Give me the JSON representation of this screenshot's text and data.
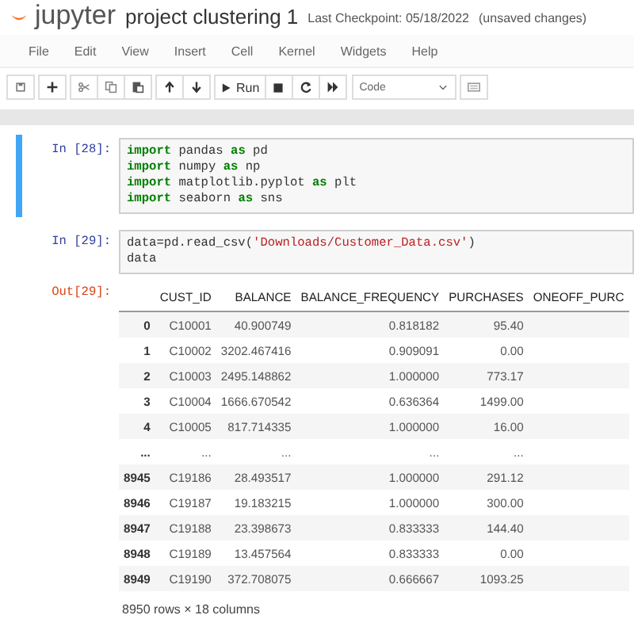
{
  "header": {
    "logo": "jupyter",
    "title": "project clustering 1",
    "checkpoint": "Last Checkpoint: 05/18/2022",
    "status": "(unsaved changes)"
  },
  "menu": [
    "File",
    "Edit",
    "View",
    "Insert",
    "Cell",
    "Kernel",
    "Widgets",
    "Help"
  ],
  "toolbar": {
    "run_label": "Run",
    "cell_type": "Code"
  },
  "cells": [
    {
      "prompt": "In [28]:",
      "selected": true,
      "lines": [
        [
          {
            "kind": "keyword",
            "text": "import"
          },
          {
            "kind": "plain",
            "text": " pandas "
          },
          {
            "kind": "keyword",
            "text": "as"
          },
          {
            "kind": "plain",
            "text": " pd"
          }
        ],
        [
          {
            "kind": "keyword",
            "text": "import"
          },
          {
            "kind": "plain",
            "text": " numpy "
          },
          {
            "kind": "keyword",
            "text": "as"
          },
          {
            "kind": "plain",
            "text": " np"
          }
        ],
        [
          {
            "kind": "keyword",
            "text": "import"
          },
          {
            "kind": "plain",
            "text": " matplotlib.pyplot "
          },
          {
            "kind": "keyword",
            "text": "as"
          },
          {
            "kind": "plain",
            "text": " plt"
          }
        ],
        [
          {
            "kind": "keyword",
            "text": "import"
          },
          {
            "kind": "plain",
            "text": " seaborn "
          },
          {
            "kind": "keyword",
            "text": "as"
          },
          {
            "kind": "plain",
            "text": " sns"
          }
        ]
      ]
    },
    {
      "prompt": "In [29]:",
      "selected": false,
      "lines": [
        [
          {
            "kind": "plain",
            "text": "data=pd.read_csv("
          },
          {
            "kind": "string",
            "text": "'Downloads/Customer_Data.csv'"
          },
          {
            "kind": "plain",
            "text": ")"
          }
        ],
        [
          {
            "kind": "plain",
            "text": "data"
          }
        ]
      ],
      "output": {
        "prompt": "Out[29]:",
        "columns": [
          "",
          "CUST_ID",
          "BALANCE",
          "BALANCE_FREQUENCY",
          "PURCHASES",
          "ONEOFF_PURC"
        ],
        "rows": [
          [
            "0",
            "C10001",
            "40.900749",
            "0.818182",
            "95.40"
          ],
          [
            "1",
            "C10002",
            "3202.467416",
            "0.909091",
            "0.00"
          ],
          [
            "2",
            "C10003",
            "2495.148862",
            "1.000000",
            "773.17"
          ],
          [
            "3",
            "C10004",
            "1666.670542",
            "0.636364",
            "1499.00"
          ],
          [
            "4",
            "C10005",
            "817.714335",
            "1.000000",
            "16.00"
          ],
          [
            "...",
            "...",
            "...",
            "...",
            "..."
          ],
          [
            "8945",
            "C19186",
            "28.493517",
            "1.000000",
            "291.12"
          ],
          [
            "8946",
            "C19187",
            "19.183215",
            "1.000000",
            "300.00"
          ],
          [
            "8947",
            "C19188",
            "23.398673",
            "0.833333",
            "144.40"
          ],
          [
            "8948",
            "C19189",
            "13.457564",
            "0.833333",
            "0.00"
          ],
          [
            "8949",
            "C19190",
            "372.708075",
            "0.666667",
            "1093.25"
          ]
        ],
        "summary": "8950 rows × 18 columns"
      }
    }
  ]
}
